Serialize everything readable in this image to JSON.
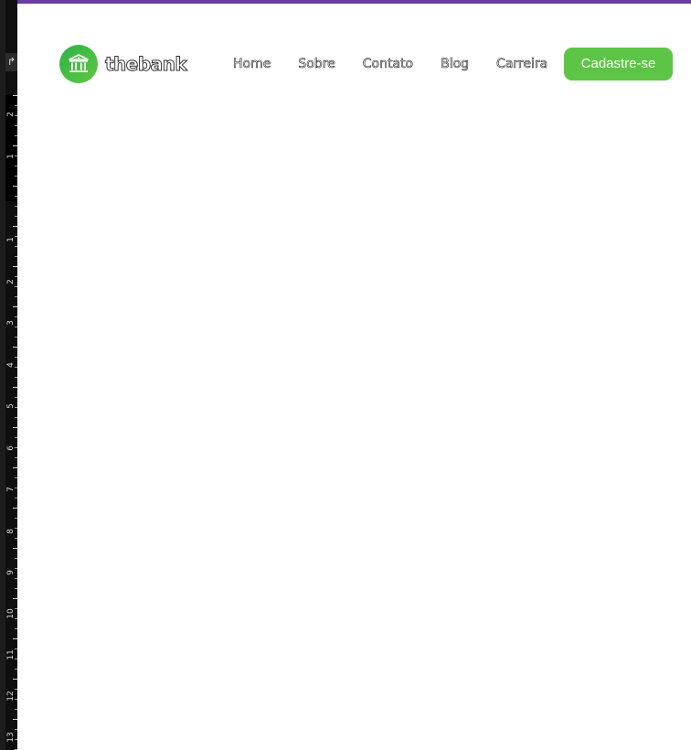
{
  "brand": {
    "name": "thebank",
    "logo_icon": "bank-building-icon",
    "accent_color": "#5cc545",
    "top_bar_color": "#6b3fa0"
  },
  "nav": {
    "items": [
      {
        "label": "Home"
      },
      {
        "label": "Sobre"
      },
      {
        "label": "Contato"
      },
      {
        "label": "Blog"
      },
      {
        "label": "Carreira"
      }
    ]
  },
  "cta": {
    "label": "Cadastre-se"
  },
  "ruler": {
    "corner_glyph": "↱",
    "numbers": [
      "2",
      "1",
      "1",
      "2",
      "3",
      "4",
      "5",
      "6",
      "7",
      "8",
      "9",
      "10",
      "11",
      "12",
      "13"
    ]
  }
}
